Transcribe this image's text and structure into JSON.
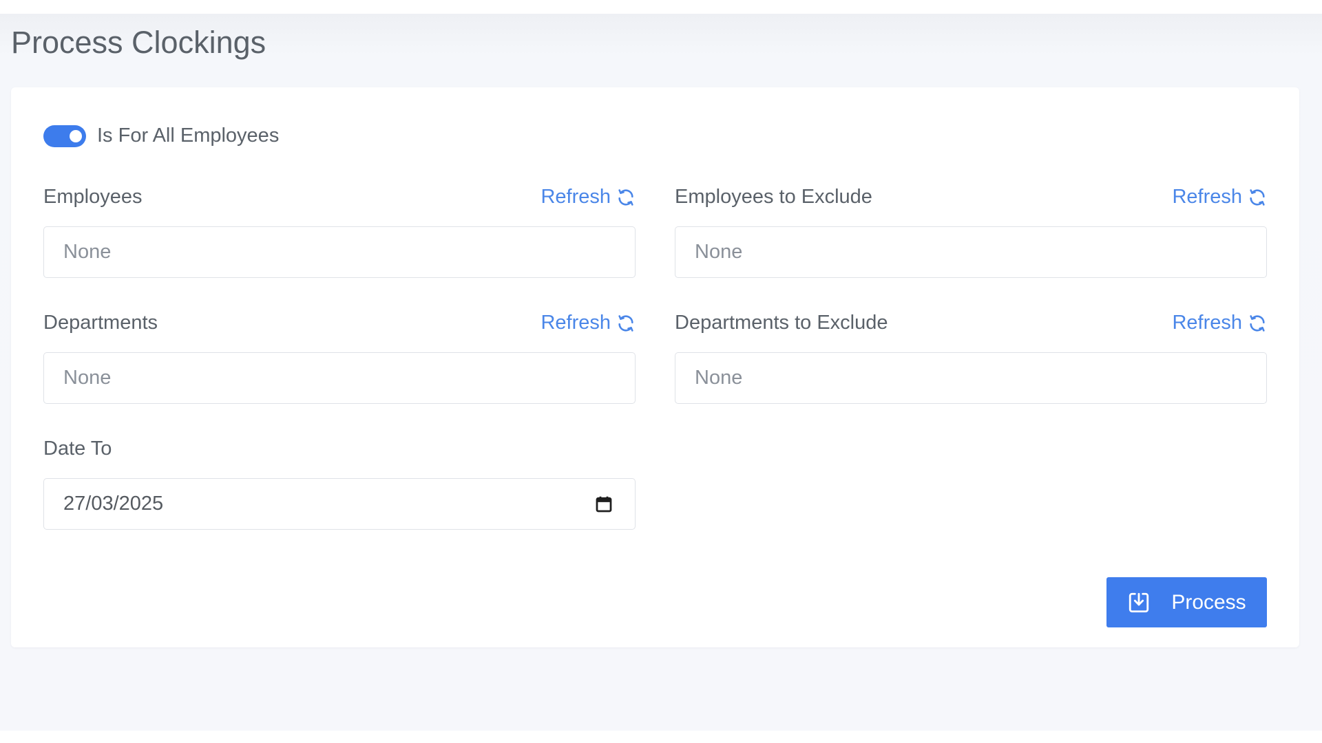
{
  "page": {
    "title": "Process Clockings"
  },
  "toggle": {
    "label": "Is For All Employees",
    "checked": true
  },
  "fields": {
    "employees": {
      "label": "Employees",
      "refresh": "Refresh",
      "value": "None"
    },
    "employees_exclude": {
      "label": "Employees to Exclude",
      "refresh": "Refresh",
      "value": "None"
    },
    "departments": {
      "label": "Departments",
      "refresh": "Refresh",
      "value": "None"
    },
    "departments_exclude": {
      "label": "Departments to Exclude",
      "refresh": "Refresh",
      "value": "None"
    },
    "date_to": {
      "label": "Date To",
      "value": "27/03/2025"
    }
  },
  "actions": {
    "process_label": "Process"
  },
  "icons": {
    "refresh": "refresh-icon",
    "calendar": "calendar-icon",
    "process": "download-box-icon"
  },
  "colors": {
    "accent": "#3f7ded",
    "link": "#4a86e8",
    "background": "#f5f7fb",
    "card": "#ffffff"
  }
}
